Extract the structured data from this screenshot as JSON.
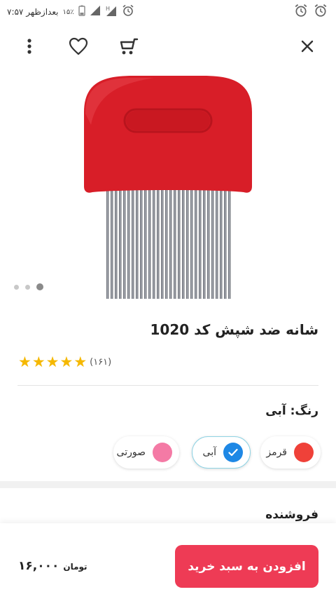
{
  "status_bar": {
    "time": "۷:۵۷ بعدازظهر",
    "battery": "۱۵٪"
  },
  "product": {
    "title": "شانه ضد شپش کد 1020",
    "rating_count": "(۱۶۱)",
    "rating_stars": 5,
    "image_pages": 3,
    "current_page": 3
  },
  "color": {
    "label": "رنگ: آبی",
    "options": [
      {
        "label": "قرمز",
        "hex": "#ef4139"
      },
      {
        "label": "آبی",
        "hex": "#1e88e5"
      },
      {
        "label": "صورتی",
        "hex": "#f47aa5"
      }
    ],
    "selected": "آبی"
  },
  "seller": {
    "label": "فروشنده"
  },
  "bottom": {
    "add_to_cart": "افزودن به سبد خرید",
    "price": "۱۶,۰۰۰",
    "currency": "تومان"
  },
  "colors": {
    "accent": "#ee3b55",
    "star": "#f5b800",
    "comb": "#d81e28"
  },
  "icons": [
    "more-vert-icon",
    "heart-icon",
    "cart-icon",
    "close-icon",
    "alarm-icon",
    "battery-icon",
    "signal-icon"
  ]
}
